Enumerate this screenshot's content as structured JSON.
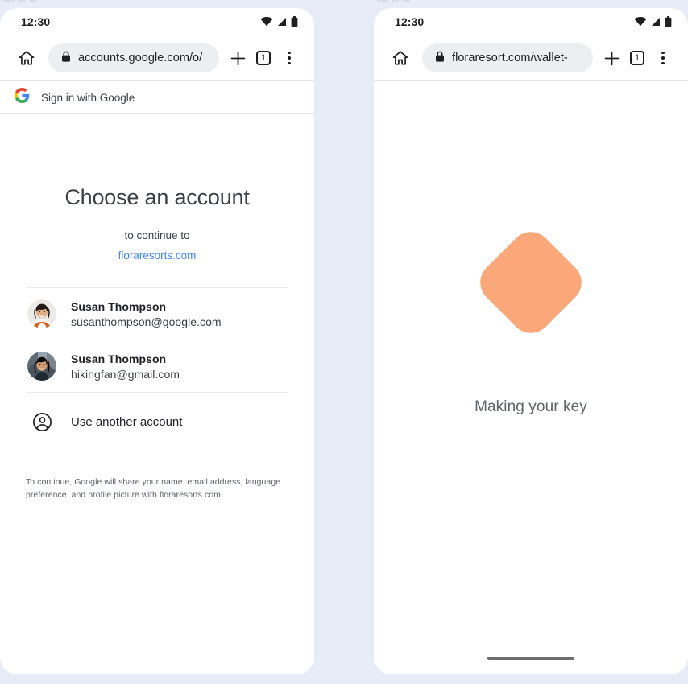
{
  "background_color": "#e8ecf7",
  "phones": {
    "left": {
      "status_bar": {
        "time": "12:30",
        "icons": [
          "wifi-icon",
          "signal-icon",
          "battery-icon"
        ]
      },
      "toolbar": {
        "home_icon": "home-icon",
        "lock_icon": "lock-icon",
        "url": "accounts.google.com/o/",
        "new_tab_icon": "plus-icon",
        "tab_count": "1",
        "menu_icon": "more-vertical-icon"
      },
      "google_header": {
        "logo": "google-g-icon",
        "label": "Sign in with Google"
      },
      "chooser": {
        "title": "Choose an account",
        "subtitle": "to continue to",
        "domain": "floraresorts.com",
        "accounts": [
          {
            "name": "Susan Thompson",
            "email": "susanthompson@google.com",
            "avatar": "avatar-photo-susan-work"
          },
          {
            "name": "Susan Thompson",
            "email": "hikingfan@gmail.com",
            "avatar": "avatar-photo-susan-personal"
          }
        ],
        "use_another": {
          "icon": "account-circle-icon",
          "label": "Use another account"
        },
        "footer": "To continue, Google will share your name, email address, language preference, and profile picture with floraresorts.com"
      }
    },
    "right": {
      "status_bar": {
        "time": "12:30",
        "icons": [
          "wifi-icon",
          "signal-icon",
          "battery-icon"
        ]
      },
      "toolbar": {
        "home_icon": "home-icon",
        "lock_icon": "lock-icon",
        "url": "floraresort.com/wallet-",
        "new_tab_icon": "plus-icon",
        "tab_count": "1",
        "menu_icon": "more-vertical-icon"
      },
      "wallet": {
        "key_shape_color": "#faa87a",
        "caption": "Making your key",
        "home_indicator": true
      }
    }
  },
  "colors": {
    "link_blue": "#4285f4",
    "key_peach": "#faa87a",
    "omnibox_grey": "#eceef0",
    "text_primary": "#202124",
    "text_secondary": "#5f6368"
  }
}
